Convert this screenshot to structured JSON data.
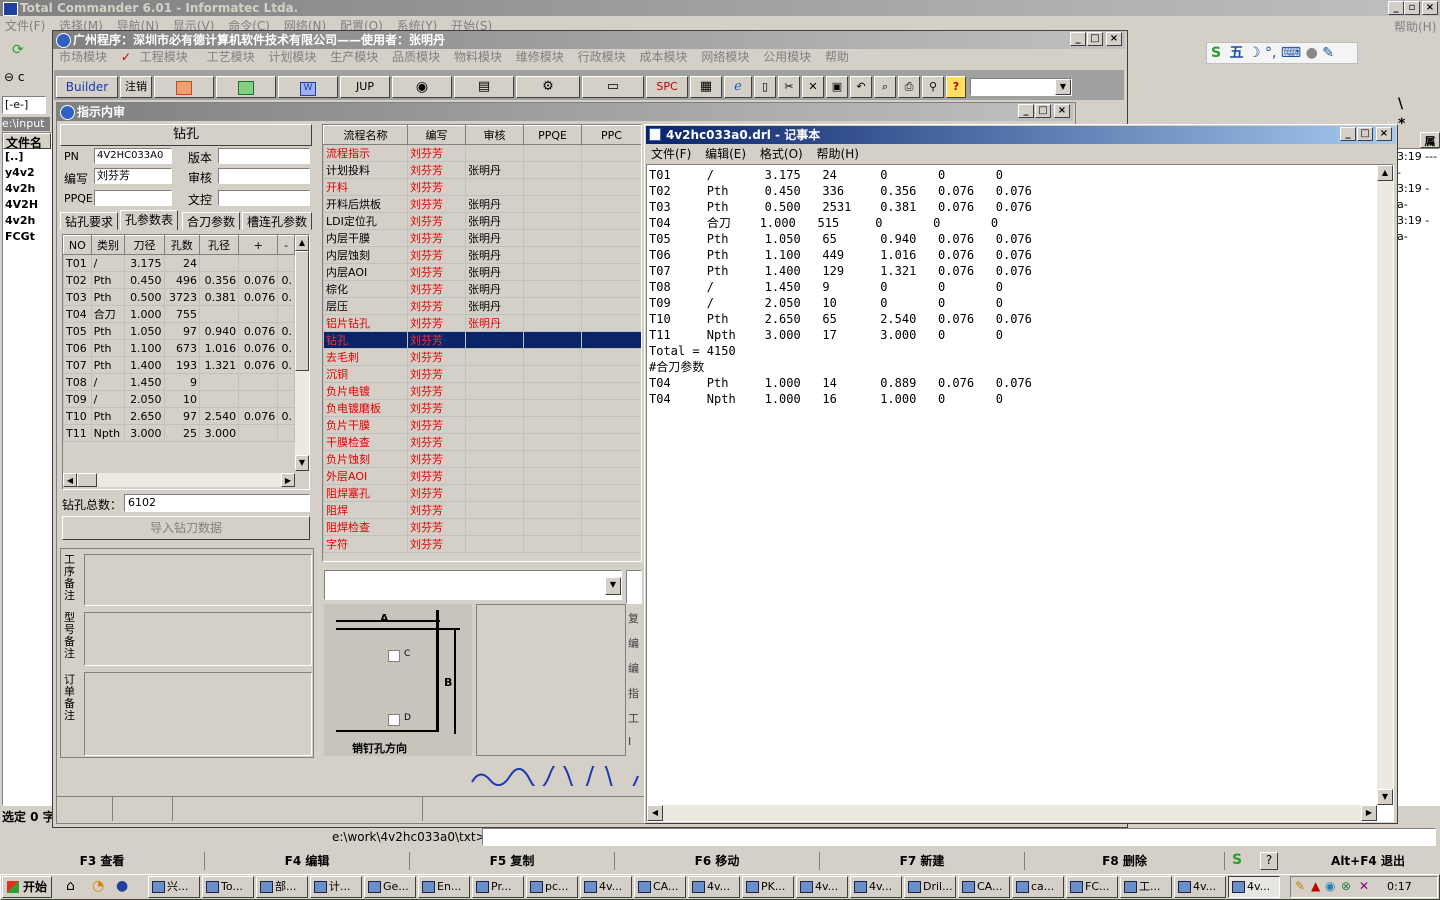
{
  "tc": {
    "title": "Total Commander 6.01 - Informatec Ltda.",
    "menu": [
      "文件(F)",
      "选择(M)",
      "导航(N)",
      "显示(V)",
      "命令(C)",
      "网络(N)",
      "配置(O)",
      "系统(Y)",
      "开始(S)"
    ],
    "help": "帮助(H)",
    "drive": "[-e-]",
    "path_left": "e:\\input",
    "col_header": "文件名",
    "files": [
      "[..]",
      "y4v2",
      "4v2h",
      "4V2H",
      "4v2h",
      "FCGt"
    ],
    "time_col": [
      "3:19 ----",
      "3:19 -a-",
      "3:19 -a-"
    ],
    "right_header": "属",
    "selected_info": "选定 0 字",
    "cmd_path": "e:\\work\\4v2hc033a0\\txt>",
    "fkeys": [
      "F3 查看",
      "F4 编辑",
      "F5 复制",
      "F6 移动",
      "F7 新建",
      "F8 删除",
      "Alt+F4 退出"
    ]
  },
  "app": {
    "title": "广州程序：深圳市必有德计算机软件技术有限公司——使用者：张明丹",
    "menu": [
      "市场模块",
      "工程模块",
      "工艺模块",
      "计划模块",
      "生产模块",
      "品质模块",
      "物料模块",
      "维修模块",
      "行政模块",
      "成本模块",
      "网络模块",
      "公用模块",
      "帮助"
    ],
    "toolbar": [
      "Builder",
      "注销",
      "JUP",
      "SPC"
    ]
  },
  "inner": {
    "title": "指示内审",
    "section_title": "钻孔",
    "pn_label": "PN",
    "pn_value": "4V2HC033A0",
    "version_label": "版本",
    "editor_label": "编写",
    "editor_value": "刘芬芳",
    "review_label": "审核",
    "ppqe_label": "PPQE",
    "doc_label": "文控",
    "tabs": [
      "钻孔要求",
      "孔参数表",
      "合刀参数",
      "槽连孔参数"
    ],
    "drill_headers": [
      "NO",
      "类别",
      "刀径",
      "孔数",
      "孔径",
      "+",
      "-"
    ],
    "drill_rows": [
      [
        "T01",
        "/",
        "3.175",
        "24",
        "",
        "",
        ""
      ],
      [
        "T02",
        "Pth",
        "0.450",
        "496",
        "0.356",
        "0.076",
        "0."
      ],
      [
        "T03",
        "Pth",
        "0.500",
        "3723",
        "0.381",
        "0.076",
        "0."
      ],
      [
        "T04",
        "合刀",
        "1.000",
        "755",
        "",
        "",
        ""
      ],
      [
        "T05",
        "Pth",
        "1.050",
        "97",
        "0.940",
        "0.076",
        "0."
      ],
      [
        "T06",
        "Pth",
        "1.100",
        "673",
        "1.016",
        "0.076",
        "0."
      ],
      [
        "T07",
        "Pth",
        "1.400",
        "193",
        "1.321",
        "0.076",
        "0."
      ],
      [
        "T08",
        "/",
        "1.450",
        "9",
        "",
        "",
        ""
      ],
      [
        "T09",
        "/",
        "2.050",
        "10",
        "",
        "",
        ""
      ],
      [
        "T10",
        "Pth",
        "2.650",
        "97",
        "2.540",
        "0.076",
        "0."
      ],
      [
        "T11",
        "Npth",
        "3.000",
        "25",
        "3.000",
        "",
        ""
      ]
    ],
    "total_label": "钻孔总数：",
    "total_value": "6102",
    "import_button": "导入钻刀数据",
    "notes": [
      "工序备注",
      "型号备注",
      "订单备注"
    ],
    "flow_headers": [
      "流程名称",
      "编写",
      "审核",
      "PPQE",
      "PPC"
    ],
    "flow_rows": [
      {
        "name": "流程指示",
        "author": "刘芬芳",
        "reviewer": "",
        "red": true
      },
      {
        "name": "计划投料",
        "author": "刘芬芳",
        "reviewer": "张明丹",
        "red": false
      },
      {
        "name": "开料",
        "author": "刘芬芳",
        "reviewer": "",
        "red": true
      },
      {
        "name": "开料后烘板",
        "author": "刘芬芳",
        "reviewer": "张明丹",
        "red": false
      },
      {
        "name": "LDI定位孔",
        "author": "刘芬芳",
        "reviewer": "张明丹",
        "red": false
      },
      {
        "name": "内层干膜",
        "author": "刘芬芳",
        "reviewer": "张明丹",
        "red": false
      },
      {
        "name": "内层蚀刻",
        "author": "刘芬芳",
        "reviewer": "张明丹",
        "red": false
      },
      {
        "name": "内层AOI",
        "author": "刘芬芳",
        "reviewer": "张明丹",
        "red": false
      },
      {
        "name": "棕化",
        "author": "刘芬芳",
        "reviewer": "张明丹",
        "red": false
      },
      {
        "name": "层压",
        "author": "刘芬芳",
        "reviewer": "张明丹",
        "red": false
      },
      {
        "name": "铝片钻孔",
        "author": "刘芬芳",
        "reviewer": "张明丹",
        "red": true
      },
      {
        "name": "钻孔",
        "author": "刘芬芳",
        "reviewer": "",
        "red": true,
        "selected": true
      },
      {
        "name": "去毛刺",
        "author": "刘芬芳",
        "reviewer": "",
        "red": true
      },
      {
        "name": "沉铜",
        "author": "刘芬芳",
        "reviewer": "",
        "red": true
      },
      {
        "name": "负片电镀",
        "author": "刘芬芳",
        "reviewer": "",
        "red": true
      },
      {
        "name": "负电镀磨板",
        "author": "刘芬芳",
        "reviewer": "",
        "red": true
      },
      {
        "name": "负片干膜",
        "author": "刘芬芳",
        "reviewer": "",
        "red": true
      },
      {
        "name": "干膜检查",
        "author": "刘芬芳",
        "reviewer": "",
        "red": true
      },
      {
        "name": "负片蚀刻",
        "author": "刘芬芳",
        "reviewer": "",
        "red": true
      },
      {
        "name": "外层AOI",
        "author": "刘芬芳",
        "reviewer": "",
        "red": true
      },
      {
        "name": "阻焊塞孔",
        "author": "刘芬芳",
        "reviewer": "",
        "red": true
      },
      {
        "name": "阻焊",
        "author": "刘芬芳",
        "reviewer": "",
        "red": true
      },
      {
        "name": "阻焊检查",
        "author": "刘芬芳",
        "reviewer": "",
        "red": true
      },
      {
        "name": "字符",
        "author": "刘芬芳",
        "reviewer": "",
        "red": true
      }
    ],
    "diagram": {
      "a": "A",
      "b": "B",
      "c": "C",
      "d": "D",
      "caption": "销钉孔方向"
    },
    "side_buttons": [
      "复",
      "编",
      "编",
      "指",
      "工",
      "I"
    ]
  },
  "notepad": {
    "title": "4v2hc033a0.drl - 记事本",
    "menu": [
      "文件(F)",
      "编辑(E)",
      "格式(O)",
      "帮助(H)"
    ],
    "lines": [
      "T01     /       3.175   24      0       0       0",
      "T02     Pth     0.450   336     0.356   0.076   0.076",
      "T03     Pth     0.500   2531    0.381   0.076   0.076",
      "T04     合刀    1.000   515     0       0       0",
      "T05     Pth     1.050   65      0.940   0.076   0.076",
      "T06     Pth     1.100   449     1.016   0.076   0.076",
      "T07     Pth     1.400   129     1.321   0.076   0.076",
      "T08     /       1.450   9       0       0       0",
      "T09     /       2.050   10      0       0       0",
      "T10     Pth     2.650   65      2.540   0.076   0.076",
      "T11     Npth    3.000   17      3.000   0       0",
      "Total = 4150",
      "#合刀参数",
      "T04     Pth     1.000   14      0.889   0.076   0.076",
      "T04     Npth    1.000   16      1.000   0       0"
    ]
  },
  "ime": {
    "mode": "五"
  },
  "taskbar": {
    "start": "开始",
    "tasks": [
      "兴...",
      "To...",
      "部...",
      "计...",
      "Ge...",
      "En...",
      "Pr...",
      "pc...",
      "4v...",
      "CA...",
      "4v...",
      "PK...",
      "4v...",
      "4v...",
      "Dril...",
      "CA...",
      "ca...",
      "FC...",
      "工...",
      "4v...",
      "4v..."
    ],
    "clock": "0:17"
  }
}
